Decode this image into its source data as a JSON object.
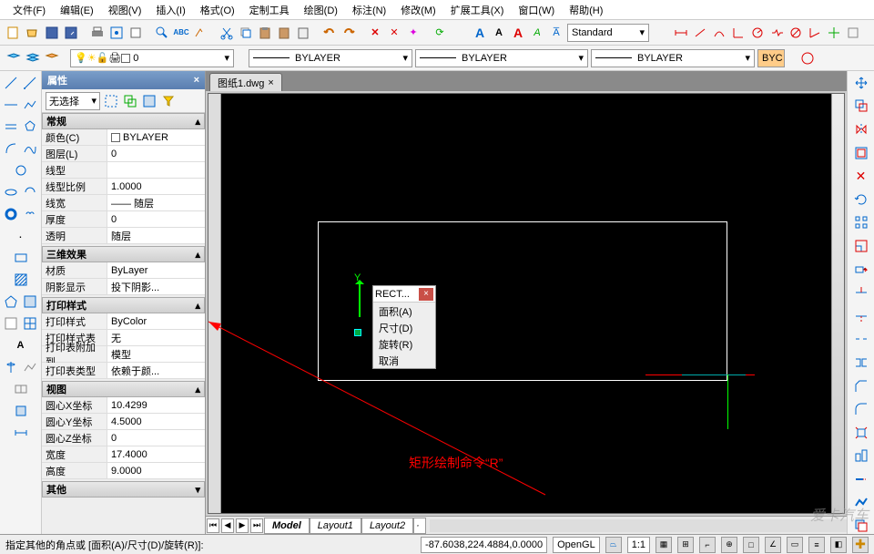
{
  "menu": [
    "文件(F)",
    "编辑(E)",
    "视图(V)",
    "插入(I)",
    "格式(O)",
    "定制工具",
    "绘图(D)",
    "标注(N)",
    "修改(M)",
    "扩展工具(X)",
    "窗口(W)",
    "帮助(H)"
  ],
  "textStyle": "Standard",
  "layerCurrent": "0",
  "linetype": "BYLAYER",
  "lineweight": "BYLAYER",
  "linetype2": "BYLAYER",
  "lwBtn": "BYC",
  "panel": {
    "title": "属性",
    "noSel": "无选择",
    "groups": {
      "general": {
        "title": "常规",
        "rows": [
          {
            "label": "颜色(C)",
            "val": "BYLAYER",
            "swatch": true
          },
          {
            "label": "图层(L)",
            "val": "0"
          },
          {
            "label": "线型",
            "val": ""
          },
          {
            "label": "线型比例",
            "val": "1.0000"
          },
          {
            "label": "线宽",
            "val": "—— 随层"
          },
          {
            "label": "厚度",
            "val": "0"
          },
          {
            "label": "透明",
            "val": "随层"
          }
        ]
      },
      "threed": {
        "title": "三维效果",
        "rows": [
          {
            "label": "材质",
            "val": "ByLayer"
          },
          {
            "label": "阴影显示",
            "val": "投下阴影..."
          }
        ]
      },
      "print": {
        "title": "打印样式",
        "rows": [
          {
            "label": "打印样式",
            "val": "ByColor"
          },
          {
            "label": "打印样式表",
            "val": "无"
          },
          {
            "label": "打印表附加到",
            "val": "模型"
          },
          {
            "label": "打印表类型",
            "val": "依赖于颜..."
          }
        ]
      },
      "view": {
        "title": "视图",
        "rows": [
          {
            "label": "圆心X坐标",
            "val": "10.4299"
          },
          {
            "label": "圆心Y坐标",
            "val": "4.5000"
          },
          {
            "label": "圆心Z坐标",
            "val": "0"
          },
          {
            "label": "宽度",
            "val": "17.4000"
          },
          {
            "label": "高度",
            "val": "9.0000"
          }
        ]
      },
      "other": {
        "title": "其他"
      }
    }
  },
  "tab": {
    "name": "图纸1.dwg",
    "close": "×"
  },
  "axis": {
    "y": "Y"
  },
  "popup": {
    "title": "RECT...",
    "items": [
      "面积(A)",
      "尺寸(D)",
      "旋转(R)",
      "取消"
    ]
  },
  "annotation": "矩形绘制命令“R”",
  "tabsBot": [
    "Model",
    "Layout1",
    "Layout2"
  ],
  "status": {
    "prompt": "指定其他的角点或 [面积(A)/尺寸(D)/旋转(R)]:",
    "coords": "-87.6038,224.4884,0.0000",
    "render": "OpenGL",
    "scale": "1:1"
  },
  "watermark": "爱卡汽车"
}
